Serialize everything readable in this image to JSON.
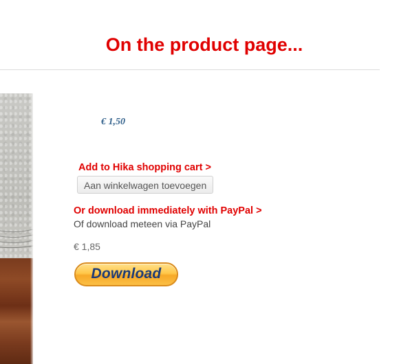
{
  "heading": "On the product page...",
  "product": {
    "price": "€ 1,50",
    "image_name": "product-photo"
  },
  "hika": {
    "callout": "Add to Hika shopping cart >",
    "cart_button_label": "Aan winkelwagen toevoegen"
  },
  "paypal": {
    "callout": "Or download immediately with PayPal >",
    "description": "Of download meteen via PayPal",
    "price": "€ 1,85",
    "download_button_label": "Download"
  },
  "colors": {
    "callout_red": "#e00000",
    "price_blue": "#2f5f8a",
    "paypal_orange": "#f7a928",
    "paypal_text_blue": "#1b3a78"
  }
}
